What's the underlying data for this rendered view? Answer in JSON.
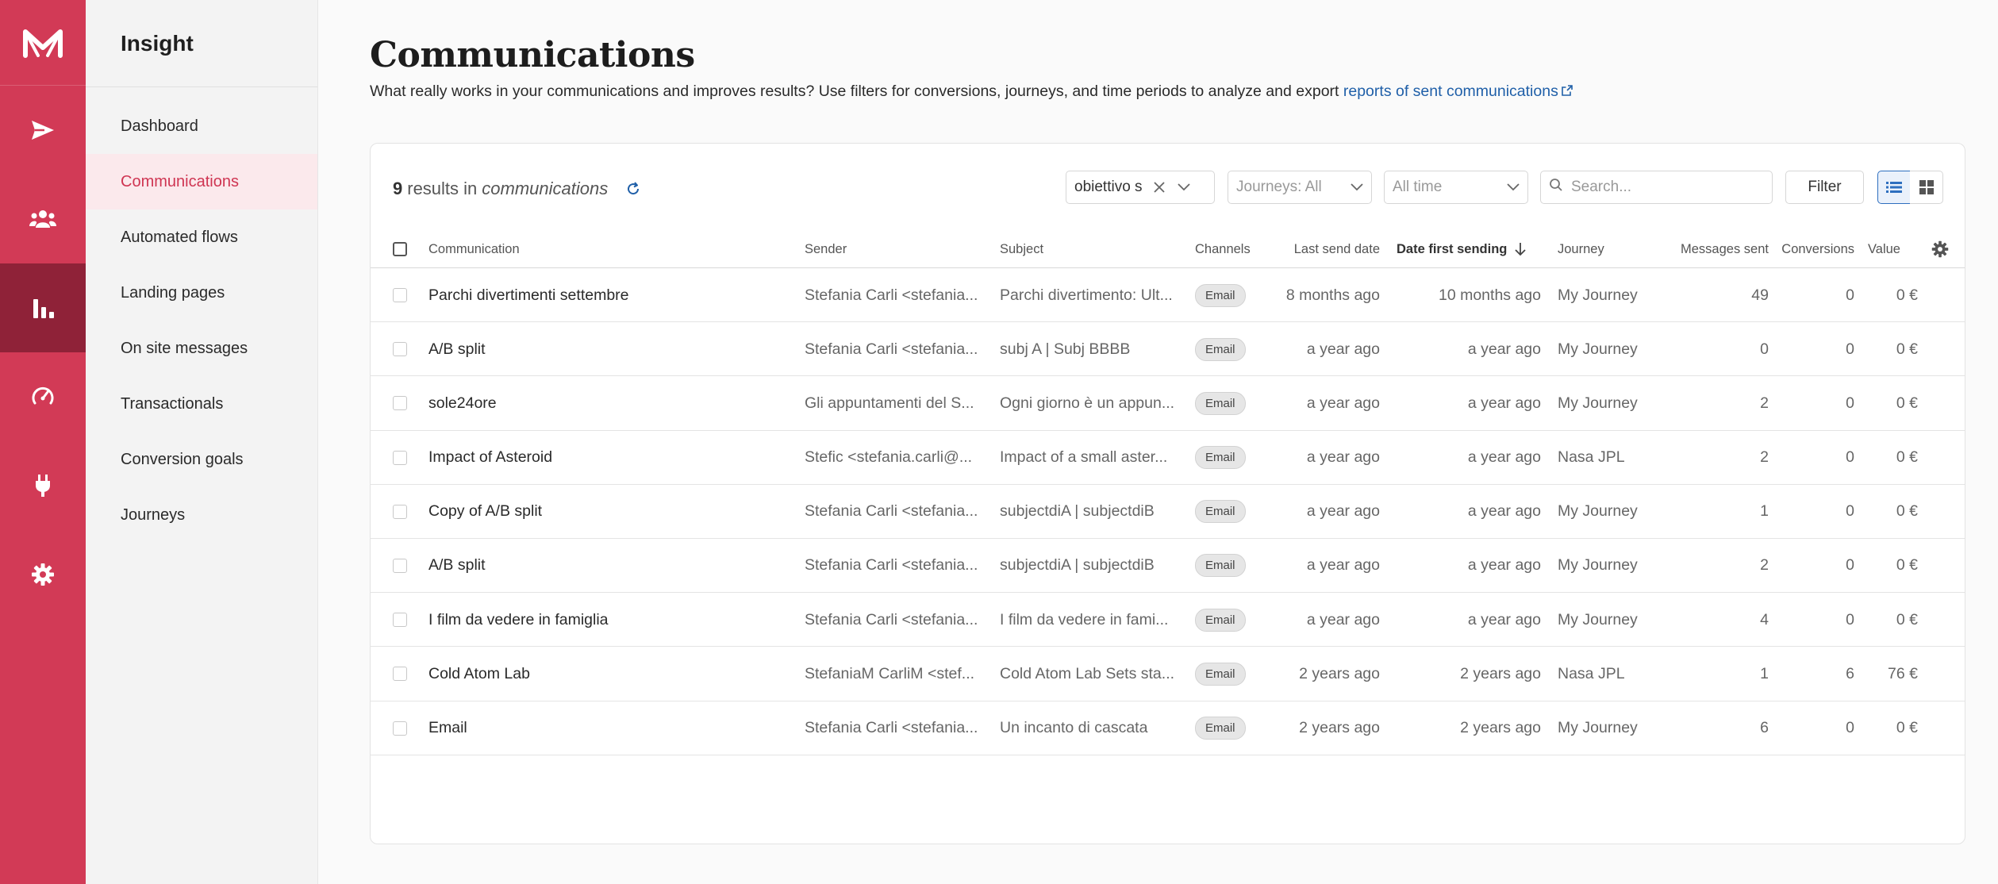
{
  "app": {
    "rail": [
      {
        "icon": "send-icon"
      },
      {
        "icon": "users-icon"
      },
      {
        "icon": "bar-chart-icon",
        "active": true
      },
      {
        "icon": "gauge-icon"
      },
      {
        "icon": "plug-icon"
      },
      {
        "icon": "gear-icon"
      }
    ],
    "colors": {
      "brand": "#d23a56",
      "brand_dark": "#8f2238",
      "link": "#1f5fa8",
      "active_nav": "#cf3552"
    }
  },
  "sidebar": {
    "title": "Insight",
    "items": [
      {
        "label": "Dashboard"
      },
      {
        "label": "Communications",
        "active": true
      },
      {
        "label": "Automated flows"
      },
      {
        "label": "Landing pages"
      },
      {
        "label": "On site messages"
      },
      {
        "label": "Transactionals"
      },
      {
        "label": "Conversion goals"
      },
      {
        "label": "Journeys"
      }
    ]
  },
  "page": {
    "title": "Communications",
    "description": "What really works in your communications and improves results? Use filters for conversions, journeys, and time periods to analyze and export ",
    "link_label": "reports of sent communications"
  },
  "toolbar": {
    "results_count": "9",
    "results_text": "results in",
    "results_scope": "communications",
    "goal_filter_value": "obiettivo s",
    "journeys_placeholder": "Journeys: All",
    "time_placeholder": "All time",
    "search_placeholder": "Search...",
    "filter_label": "Filter"
  },
  "table": {
    "headers": {
      "communication": "Communication",
      "sender": "Sender",
      "subject": "Subject",
      "channels": "Channels",
      "last_send": "Last send date",
      "first_send": "Date first sending",
      "journey": "Journey",
      "messages": "Messages sent",
      "conversions": "Conversions",
      "value": "Value"
    },
    "rows": [
      {
        "name": "Parchi divertimenti settembre",
        "sender": "Stefania Carli <stefania...",
        "subject": "Parchi divertimento: Ult...",
        "channel": "Email",
        "last": "8 months ago",
        "first": "10 months ago",
        "journey": "My Journey",
        "sent": "49",
        "conv": "0",
        "value": "0 €"
      },
      {
        "name": "A/B split",
        "sender": "Stefania Carli <stefania...",
        "subject": "subj A | Subj BBBB",
        "channel": "Email",
        "last": "a year ago",
        "first": "a year ago",
        "journey": "My Journey",
        "sent": "0",
        "conv": "0",
        "value": "0 €"
      },
      {
        "name": "sole24ore",
        "sender": "Gli appuntamenti del S...",
        "subject": "Ogni giorno è un appun...",
        "channel": "Email",
        "last": "a year ago",
        "first": "a year ago",
        "journey": "My Journey",
        "sent": "2",
        "conv": "0",
        "value": "0 €"
      },
      {
        "name": "Impact of Asteroid",
        "sender": "Stefic <stefania.carli@...",
        "subject": "Impact of a small aster...",
        "channel": "Email",
        "last": "a year ago",
        "first": "a year ago",
        "journey": "Nasa JPL",
        "sent": "2",
        "conv": "0",
        "value": "0 €"
      },
      {
        "name": "Copy of A/B split",
        "sender": "Stefania Carli <stefania...",
        "subject": "subjectdiA | subjectdiB",
        "channel": "Email",
        "last": "a year ago",
        "first": "a year ago",
        "journey": "My Journey",
        "sent": "1",
        "conv": "0",
        "value": "0 €"
      },
      {
        "name": "A/B split",
        "sender": "Stefania Carli <stefania...",
        "subject": "subjectdiA | subjectdiB",
        "channel": "Email",
        "last": "a year ago",
        "first": "a year ago",
        "journey": "My Journey",
        "sent": "2",
        "conv": "0",
        "value": "0 €"
      },
      {
        "name": "I film da vedere in famiglia",
        "sender": "Stefania Carli <stefania...",
        "subject": "I film da vedere in fami...",
        "channel": "Email",
        "last": "a year ago",
        "first": "a year ago",
        "journey": "My Journey",
        "sent": "4",
        "conv": "0",
        "value": "0 €"
      },
      {
        "name": "Cold Atom Lab",
        "sender": "StefaniaM CarliM <stef...",
        "subject": "Cold Atom Lab Sets sta...",
        "channel": "Email",
        "last": "2 years ago",
        "first": "2 years ago",
        "journey": "Nasa JPL",
        "sent": "1",
        "conv": "6",
        "value": "76 €"
      },
      {
        "name": "Email",
        "sender": "Stefania Carli <stefania...",
        "subject": "Un incanto di cascata",
        "channel": "Email",
        "last": "2 years ago",
        "first": "2 years ago",
        "journey": "My Journey",
        "sent": "6",
        "conv": "0",
        "value": "0 €"
      }
    ]
  }
}
